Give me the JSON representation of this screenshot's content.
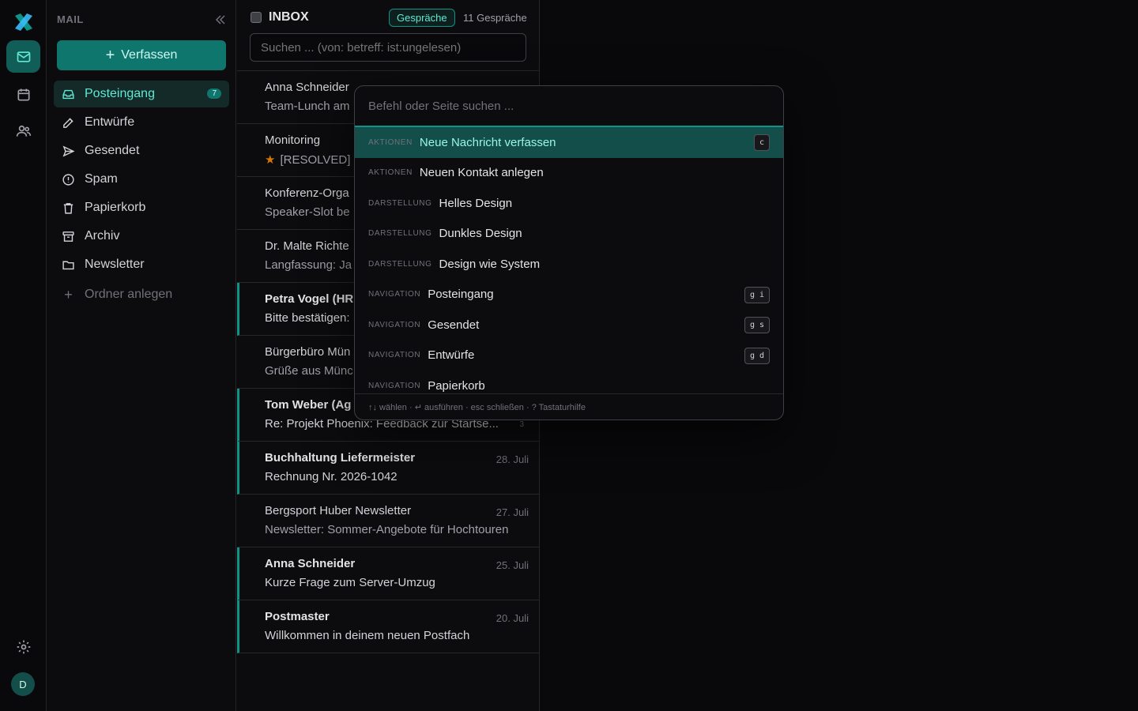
{
  "rail": {
    "icons": [
      "logo-icon",
      "mail-icon",
      "calendar-icon",
      "contacts-icon",
      "settings-icon"
    ],
    "avatar_initial": "D"
  },
  "sidebar": {
    "title": "MAIL",
    "compose_label": "Verfassen",
    "items": [
      {
        "label": "Posteingang",
        "icon": "inbox-icon",
        "badge": "7",
        "active": true
      },
      {
        "label": "Entwürfe",
        "icon": "pencil-icon"
      },
      {
        "label": "Gesendet",
        "icon": "send-icon"
      },
      {
        "label": "Spam",
        "icon": "alert-icon"
      },
      {
        "label": "Papierkorb",
        "icon": "trash-icon"
      },
      {
        "label": "Archiv",
        "icon": "archive-icon"
      },
      {
        "label": "Newsletter",
        "icon": "folder-icon"
      }
    ],
    "add_folder_label": "Ordner anlegen"
  },
  "list": {
    "title": "INBOX",
    "view_chip": "Gespräche",
    "count": "11 Gespräche",
    "search_placeholder": "Suchen ... (von: betreff: ist:ungelesen)",
    "mails": [
      {
        "from": "Anna Schneider",
        "subject": "Team-Lunch am",
        "date": "",
        "unread": false
      },
      {
        "from": "Monitoring",
        "subject": "[RESOLVED]",
        "date": "",
        "unread": false,
        "starred": true
      },
      {
        "from": "Konferenz-Orga",
        "subject": "Speaker-Slot be",
        "date": "",
        "unread": false
      },
      {
        "from": "Dr. Malte Richte",
        "subject": "Langfassung: Ja",
        "date": "",
        "unread": false
      },
      {
        "from": "Petra Vogel (HR",
        "subject": "Bitte bestätigen:",
        "date": "",
        "unread": true
      },
      {
        "from": "Bürgerbüro Mün",
        "subject": "Grüße aus Münc",
        "date": "",
        "unread": false
      },
      {
        "from": "Tom Weber (Ag",
        "subject": "Re: Projekt Phoenix: Feedback zur Startse...",
        "date": "",
        "unread": true,
        "thread": "3"
      },
      {
        "from": "Buchhaltung Liefermeister",
        "subject": "Rechnung Nr. 2026-1042",
        "date": "28. Juli",
        "unread": true
      },
      {
        "from": "Bergsport Huber Newsletter",
        "subject": "Newsletter: Sommer-Angebote für Hochtouren",
        "date": "27. Juli",
        "unread": false
      },
      {
        "from": "Anna Schneider",
        "subject": "Kurze Frage zum Server-Umzug",
        "date": "25. Juli",
        "unread": true
      },
      {
        "from": "Postmaster",
        "subject": "Willkommen in deinem neuen Postfach",
        "date": "20. Juli",
        "unread": true
      }
    ]
  },
  "palette": {
    "placeholder": "Befehl oder Seite suchen ...",
    "items": [
      {
        "category": "AKTIONEN",
        "label": "Neue Nachricht verfassen",
        "shortcut": "c",
        "selected": true
      },
      {
        "category": "AKTIONEN",
        "label": "Neuen Kontakt anlegen",
        "shortcut": ""
      },
      {
        "category": "DARSTELLUNG",
        "label": "Helles Design",
        "shortcut": ""
      },
      {
        "category": "DARSTELLUNG",
        "label": "Dunkles Design",
        "shortcut": ""
      },
      {
        "category": "DARSTELLUNG",
        "label": "Design wie System",
        "shortcut": ""
      },
      {
        "category": "NAVIGATION",
        "label": "Posteingang",
        "shortcut": "g i"
      },
      {
        "category": "NAVIGATION",
        "label": "Gesendet",
        "shortcut": "g s"
      },
      {
        "category": "NAVIGATION",
        "label": "Entwürfe",
        "shortcut": "g d"
      },
      {
        "category": "NAVIGATION",
        "label": "Papierkorb",
        "shortcut": ""
      }
    ],
    "footer": "↑↓ wählen · ↵ ausführen · esc schließen · ? Tastaturhilfe"
  },
  "colors": {
    "accent": "#0d9488",
    "accent_text": "#5eead4",
    "background": "#09090b"
  }
}
